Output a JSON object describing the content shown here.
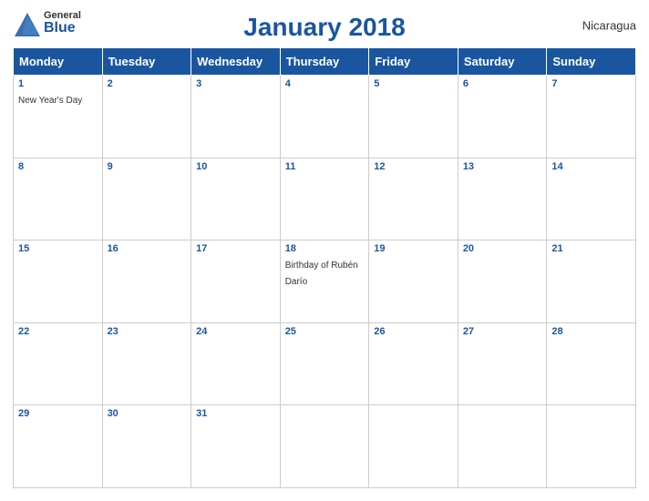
{
  "header": {
    "logo": {
      "general": "General",
      "blue": "Blue",
      "bird_symbol": "▲"
    },
    "title": "January 2018",
    "country": "Nicaragua"
  },
  "weekdays": [
    "Monday",
    "Tuesday",
    "Wednesday",
    "Thursday",
    "Friday",
    "Saturday",
    "Sunday"
  ],
  "weeks": [
    [
      {
        "day": "1",
        "holiday": "New Year's Day"
      },
      {
        "day": "2",
        "holiday": ""
      },
      {
        "day": "3",
        "holiday": ""
      },
      {
        "day": "4",
        "holiday": ""
      },
      {
        "day": "5",
        "holiday": ""
      },
      {
        "day": "6",
        "holiday": ""
      },
      {
        "day": "7",
        "holiday": ""
      }
    ],
    [
      {
        "day": "8",
        "holiday": ""
      },
      {
        "day": "9",
        "holiday": ""
      },
      {
        "day": "10",
        "holiday": ""
      },
      {
        "day": "11",
        "holiday": ""
      },
      {
        "day": "12",
        "holiday": ""
      },
      {
        "day": "13",
        "holiday": ""
      },
      {
        "day": "14",
        "holiday": ""
      }
    ],
    [
      {
        "day": "15",
        "holiday": ""
      },
      {
        "day": "16",
        "holiday": ""
      },
      {
        "day": "17",
        "holiday": ""
      },
      {
        "day": "18",
        "holiday": "Birthday of Rubén Darío"
      },
      {
        "day": "19",
        "holiday": ""
      },
      {
        "day": "20",
        "holiday": ""
      },
      {
        "day": "21",
        "holiday": ""
      }
    ],
    [
      {
        "day": "22",
        "holiday": ""
      },
      {
        "day": "23",
        "holiday": ""
      },
      {
        "day": "24",
        "holiday": ""
      },
      {
        "day": "25",
        "holiday": ""
      },
      {
        "day": "26",
        "holiday": ""
      },
      {
        "day": "27",
        "holiday": ""
      },
      {
        "day": "28",
        "holiday": ""
      }
    ],
    [
      {
        "day": "29",
        "holiday": ""
      },
      {
        "day": "30",
        "holiday": ""
      },
      {
        "day": "31",
        "holiday": ""
      },
      {
        "day": "",
        "holiday": ""
      },
      {
        "day": "",
        "holiday": ""
      },
      {
        "day": "",
        "holiday": ""
      },
      {
        "day": "",
        "holiday": ""
      }
    ]
  ],
  "colors": {
    "header_bg": "#1a56a0",
    "header_text": "#ffffff",
    "title_color": "#1a56a0",
    "day_number_color": "#1a56a0"
  }
}
